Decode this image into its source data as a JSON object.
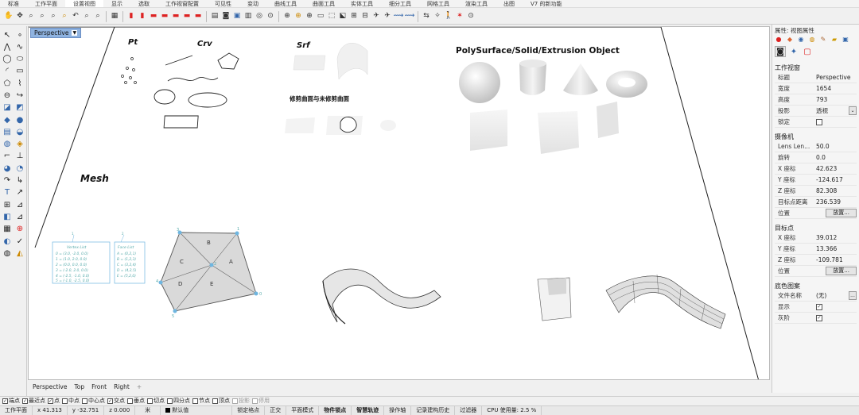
{
  "menu": {
    "tabs": [
      "标准",
      "工作平面",
      "设置视图",
      "显示",
      "选取",
      "工作视窗配置",
      "可见性",
      "变动",
      "曲线工具",
      "曲面工具",
      "实体工具",
      "细分工具",
      "网格工具",
      "渲染工具",
      "出图",
      "V7 的新功能"
    ],
    "active_index": 2
  },
  "viewport": {
    "label": "Perspective",
    "dropdown_glyph": "▼",
    "scene_labels": {
      "pt": "Pt",
      "crv": "Crv",
      "srf": "Srf",
      "polysurface": "PolySurface/Solid/Extrusion Object",
      "trimmed": "修剪曲面与未修剪曲面",
      "mesh": "Mesh"
    },
    "mesh_faces": [
      "A",
      "B",
      "C",
      "D",
      "E"
    ],
    "mesh_vertices": [
      "0",
      "1",
      "2",
      "3",
      "4",
      "5"
    ],
    "vertex_list": {
      "index": "1",
      "title": "Vertex List",
      "rows": [
        "0 = (3.0, -2.0, 0.0)",
        "1 = (1.0, 2.0, 0.0)",
        "2 = (0.0, 0.0, 0.0)",
        "3 = (-2.0, 2.0, 0.0)",
        "4 = (-2.5, -1.0, 0.0)",
        "5 = (-1.0, -2.5, 0.0)"
      ]
    },
    "face_list": {
      "index": "2",
      "title": "Face List",
      "rows": [
        "A = (0,2,1)",
        "B = (1,2,3)",
        "C = (3,2,4)",
        "D = (4,2,5)",
        "E = (5,2,0)"
      ]
    }
  },
  "viewtabs": [
    "Perspective",
    "Top",
    "Front",
    "Right"
  ],
  "viewtabs_add": "+",
  "right_panel": {
    "title": "属性: 视图属性",
    "section_viewport": "工作视窗",
    "viewport_props": [
      {
        "key": "标题",
        "value": "Perspective"
      },
      {
        "key": "宽度",
        "value": "1654"
      },
      {
        "key": "高度",
        "value": "793"
      },
      {
        "key": "投影",
        "value": "透视"
      },
      {
        "key": "锁定",
        "value": ""
      }
    ],
    "section_camera": "摄像机",
    "camera_props": [
      {
        "key": "Lens Len...",
        "value": "50.0"
      },
      {
        "key": "旋转",
        "value": "0.0"
      },
      {
        "key": "X 座标",
        "value": "42.623"
      },
      {
        "key": "Y 座标",
        "value": "-124.617"
      },
      {
        "key": "Z 座标",
        "value": "82.308"
      },
      {
        "key": "目标点距离",
        "value": "236.539"
      },
      {
        "key": "位置",
        "value": "放置..."
      }
    ],
    "section_target": "目标点",
    "target_props": [
      {
        "key": "X 座标",
        "value": "39.012"
      },
      {
        "key": "Y 座标",
        "value": "13.366"
      },
      {
        "key": "Z 座标",
        "value": "-109.781"
      },
      {
        "key": "位置",
        "value": "放置..."
      }
    ],
    "section_wallpaper": "底色图案",
    "wallpaper_props": [
      {
        "key": "文件名称",
        "value": "(无)"
      },
      {
        "key": "显示",
        "value": ""
      },
      {
        "key": "灰阶",
        "value": ""
      }
    ],
    "dropdown_glyph": "⌄",
    "browse_glyph": "...",
    "checked_glyph": "✓"
  },
  "osnaps": [
    {
      "label": "端点",
      "checked": true
    },
    {
      "label": "最近点",
      "checked": true
    },
    {
      "label": "点",
      "checked": true
    },
    {
      "label": "中点",
      "checked": false
    },
    {
      "label": "中心点",
      "checked": false
    },
    {
      "label": "交点",
      "checked": true
    },
    {
      "label": "垂点",
      "checked": false
    },
    {
      "label": "切点",
      "checked": false
    },
    {
      "label": "四分点",
      "checked": false
    },
    {
      "label": "节点",
      "checked": false
    },
    {
      "label": "顶点",
      "checked": false
    },
    {
      "label": "投影",
      "checked": false,
      "dim": true
    },
    {
      "label": "停用",
      "checked": false,
      "dim": true
    }
  ],
  "status": {
    "cplane": "工作平面",
    "x": "x 41.313",
    "y": "y -32.751",
    "z": "z 0.000",
    "unit_glyph": "米",
    "layer": "默认值",
    "grid_snap": "锁定格点",
    "ortho": "正交",
    "planar": "平面模式",
    "osnap": "物件锁点",
    "smarttrack": "智慧轨迹",
    "gumball": "操作轴",
    "history": "记录建构历史",
    "filter": "过滤器",
    "cpu": "CPU 使用量: 2.5 %"
  }
}
